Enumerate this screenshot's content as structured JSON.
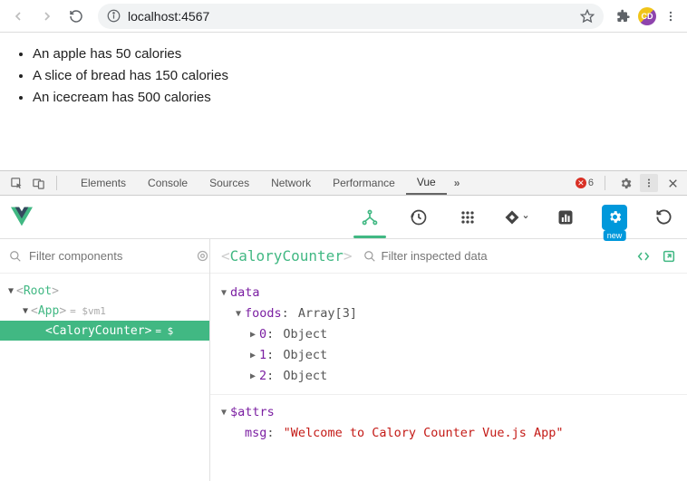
{
  "browser": {
    "url": "localhost:4567",
    "avatar_text": "CD"
  },
  "page": {
    "items": [
      "An apple has 50 calories",
      "A slice of bread has 150 calories",
      "An icecream has 500 calories"
    ]
  },
  "devtools": {
    "tabs": [
      "Elements",
      "Console",
      "Sources",
      "Network",
      "Performance",
      "Vue"
    ],
    "active_tab": "Vue",
    "error_count": "6"
  },
  "vue": {
    "new_badge": "new",
    "tree_filter_placeholder": "Filter components",
    "tree": {
      "root": "Root",
      "app": "App",
      "app_suffix": "= $vm1",
      "calory": "CaloryCounter",
      "calory_suffix": "= $"
    },
    "inspect": {
      "title": "CaloryCounter",
      "filter_placeholder": "Filter inspected data",
      "data_label": "data",
      "foods_key": "foods",
      "foods_type": "Array[3]",
      "items": [
        {
          "key": "0",
          "type": "Object"
        },
        {
          "key": "1",
          "type": "Object"
        },
        {
          "key": "2",
          "type": "Object"
        }
      ],
      "attrs_label": "$attrs",
      "msg_key": "msg",
      "msg_value": "\"Welcome to Calory Counter Vue.js App\""
    }
  }
}
